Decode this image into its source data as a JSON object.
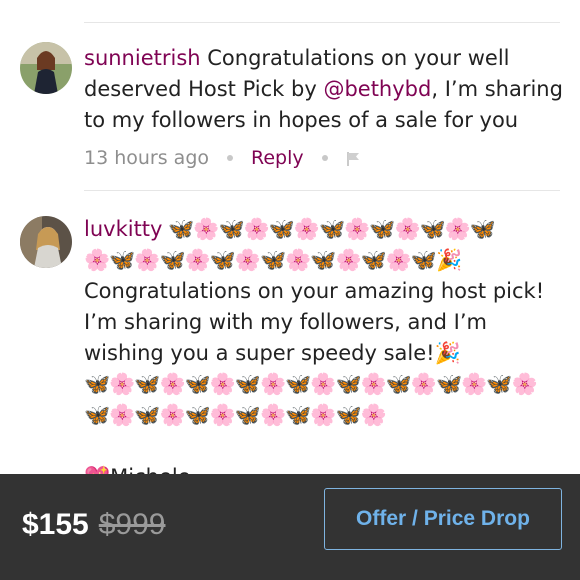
{
  "comments": [
    {
      "username": "sunnietrish",
      "text_before_mention": " Congratulations on your well deserved Host Pick by ",
      "mention": "@bethybd",
      "text_after_mention": ", I’m sharing to my followers in hopes of a sale for you",
      "time": "13 hours ago",
      "reply_label": "Reply",
      "avatar_icon": "avatar-photo"
    },
    {
      "username": "luvkitty",
      "emoji_line_1": " 🦋🌸🦋🌸🦋🌸🦋🌸🦋🌸🦋🌸🦋",
      "emoji_line_2": "🌸🦋🌸🦋🌸🦋🌸🦋🌸🦋🌸🦋🌸🦋🎉",
      "message": "Congratulations on your amazing host pick! I’m sharing with my followers, and I’m wishing you a super speedy sale!🎉",
      "emoji_line_3": "🦋🌸🦋🌸🦋🌸🦋🌸🦋🌸🦋🌸🦋🌸🦋🌸🦋🌸",
      "emoji_line_4": "🦋🌸🦋🌸🦋🌸🦋🌸🦋🌸🦋🌸",
      "signature": "💖Michele",
      "avatar_icon": "avatar-photo"
    }
  ],
  "bottom_bar": {
    "price": "$155",
    "original_price": "$999",
    "offer_button_label": "Offer / Price Drop"
  },
  "colors": {
    "accent": "#7f0353",
    "bar_background": "#333333",
    "button_text": "#6fb2ea"
  }
}
